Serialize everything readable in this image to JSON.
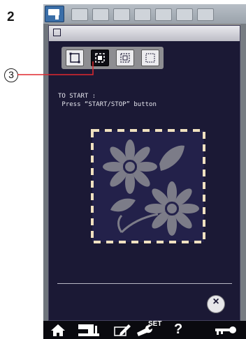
{
  "step_number": "2",
  "callout": {
    "label": "3"
  },
  "panel": {
    "header_icon": "frame-icon",
    "trace_modes": [
      {
        "name": "outline-trace-icon",
        "selected": false
      },
      {
        "name": "corner-trace-icon",
        "selected": true
      },
      {
        "name": "pattern-trace-icon",
        "selected": false
      },
      {
        "name": "dotted-trace-icon",
        "selected": false
      }
    ],
    "instruction_line1": "TO START :",
    "instruction_line2": " Press “START/STOP” button",
    "close_label": "×"
  },
  "bottom_nav": {
    "items": [
      "home-icon",
      "sewing-machine-icon",
      "embroidery-edit-icon",
      "set-wrench-icon",
      "help-icon",
      "key-icon"
    ],
    "set_label": "SET",
    "help_label": "?"
  },
  "colors": {
    "panel_background": "#1b1935",
    "design_background": "#23214a",
    "flower_gray": "#7c7c88",
    "dash_frame": "#f0e1c0"
  }
}
